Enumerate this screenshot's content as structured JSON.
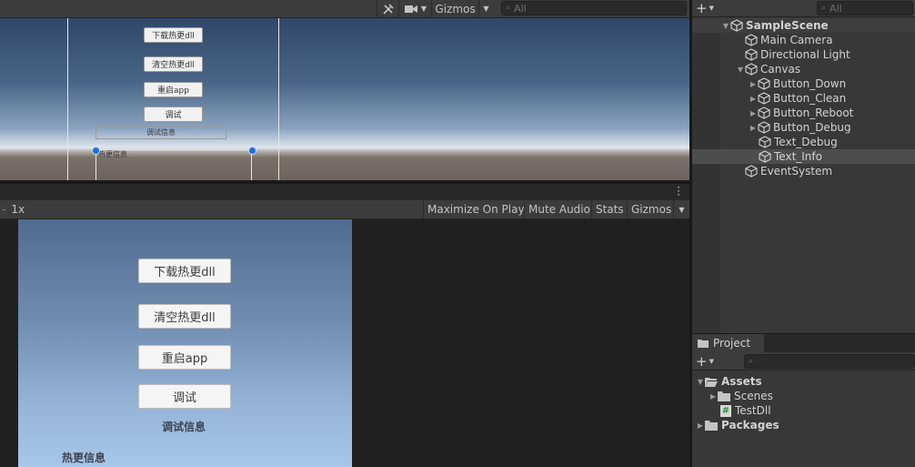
{
  "scene_view": {
    "toolbar": {
      "tools_icon": "tools-icon",
      "camera_icon": "camera-icon",
      "gizmos_label": "Gizmos",
      "search_placeholder": "All"
    },
    "buttons": [
      {
        "label": "下载热更dll"
      },
      {
        "label": "清空热更dll"
      },
      {
        "label": "重启app"
      },
      {
        "label": "调试"
      }
    ],
    "text_debug": "调试信息",
    "text_info": "热更信息"
  },
  "game_view": {
    "scale_label": "1x",
    "toolbar": {
      "maximize_on_play": "Maximize On Play",
      "mute_audio": "Mute Audio",
      "stats": "Stats",
      "gizmos": "Gizmos"
    },
    "buttons": [
      {
        "label": "下载热更dll"
      },
      {
        "label": "清空热更dll"
      },
      {
        "label": "重启app"
      },
      {
        "label": "调试"
      }
    ],
    "text_debug": "调试信息",
    "text_info": "热更信息"
  },
  "hierarchy": {
    "search_placeholder": "All",
    "items": [
      {
        "label": "SampleScene",
        "type": "scene"
      },
      {
        "label": "Main Camera"
      },
      {
        "label": "Directional Light"
      },
      {
        "label": "Canvas"
      },
      {
        "label": "Button_Down"
      },
      {
        "label": "Button_Clean"
      },
      {
        "label": "Button_Reboot"
      },
      {
        "label": "Button_Debug"
      },
      {
        "label": "Text_Debug"
      },
      {
        "label": "Text_Info",
        "selected": true
      },
      {
        "label": "EventSystem"
      }
    ]
  },
  "project": {
    "tab_label": "Project",
    "items": [
      {
        "label": "Assets"
      },
      {
        "label": "Scenes"
      },
      {
        "label": "TestDll"
      },
      {
        "label": "Packages"
      }
    ]
  },
  "colors": {
    "panel_bg": "#383838",
    "selection": "#4d4d4d",
    "handle_blue": "#1e6ee0"
  }
}
